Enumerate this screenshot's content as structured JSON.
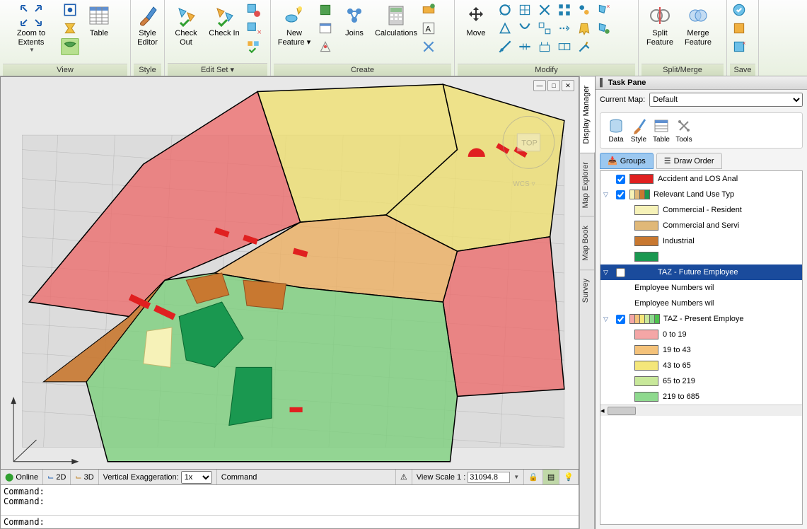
{
  "ribbon": {
    "groups": [
      {
        "label": "View"
      },
      {
        "label": "Style"
      },
      {
        "label": "Edit Set ▾"
      },
      {
        "label": "Create"
      },
      {
        "label": "Modify"
      },
      {
        "label": "Split/Merge"
      },
      {
        "label": "Save"
      }
    ],
    "zoom_extents": "Zoom to Extents",
    "table": "Table",
    "style_editor": "Style Editor",
    "check_out": "Check Out",
    "check_in": "Check In",
    "new_feature": "New Feature ▾",
    "joins": "Joins",
    "calculations": "Calculations",
    "move": "Move",
    "split_feature": "Split Feature",
    "merge_feature": "Merge Feature"
  },
  "status": {
    "online": "Online",
    "d2": "2D",
    "d3": "3D",
    "ve_label": "Vertical Exaggeration:",
    "ve_value": "1x",
    "command": "Command",
    "view_scale_label": "View Scale 1 :",
    "view_scale_value": "31094.8"
  },
  "cmd": {
    "history1": "Command:",
    "history2": "Command:",
    "prompt": "Command:"
  },
  "vtabs": {
    "display_manager": "Display Manager",
    "map_explorer": "Map Explorer",
    "map_book": "Map Book",
    "survey": "Survey"
  },
  "task_pane": {
    "title": "Task Pane",
    "current_map_label": "Current Map:",
    "current_map_value": "Default",
    "toolbar": {
      "data": "Data",
      "style": "Style",
      "table": "Table",
      "tools": "Tools"
    },
    "tabs": {
      "groups": "Groups",
      "draw_order": "Draw Order"
    }
  },
  "layers": {
    "accident": "Accident and LOS Anal",
    "landuse": "Relevant Land Use Typ",
    "landuse_items": [
      {
        "label": "Commercial - Resident",
        "color": "#f6f2b8"
      },
      {
        "label": "Commercial and Servi",
        "color": "#e0b878"
      },
      {
        "label": "Industrial",
        "color": "#c87830"
      },
      {
        "label": "",
        "color": "#1a9850"
      }
    ],
    "taz_future": "TAZ - Future Employee",
    "taz_future_items": [
      "Employee Numbers wil",
      "Employee Numbers wil"
    ],
    "taz_present": "TAZ - Present Employe",
    "taz_present_items": [
      {
        "label": "0 to 19",
        "color": "#f4a6a6"
      },
      {
        "label": "19 to 43",
        "color": "#f4c27a"
      },
      {
        "label": "43 to 65",
        "color": "#f4e67a"
      },
      {
        "label": "65 to 219",
        "color": "#c8e89a"
      },
      {
        "label": "219 to 685",
        "color": "#8ed98e"
      }
    ],
    "landuse_multiswatch": [
      "#f6f2b8",
      "#e0b878",
      "#c87830",
      "#1a9850"
    ],
    "present_multiswatch": [
      "#f4a6a6",
      "#f4c27a",
      "#f4e67a",
      "#c8e89a",
      "#8ed98e",
      "#4cc24c"
    ]
  },
  "compass": {
    "top": "TOP",
    "wcs": "WCS"
  }
}
